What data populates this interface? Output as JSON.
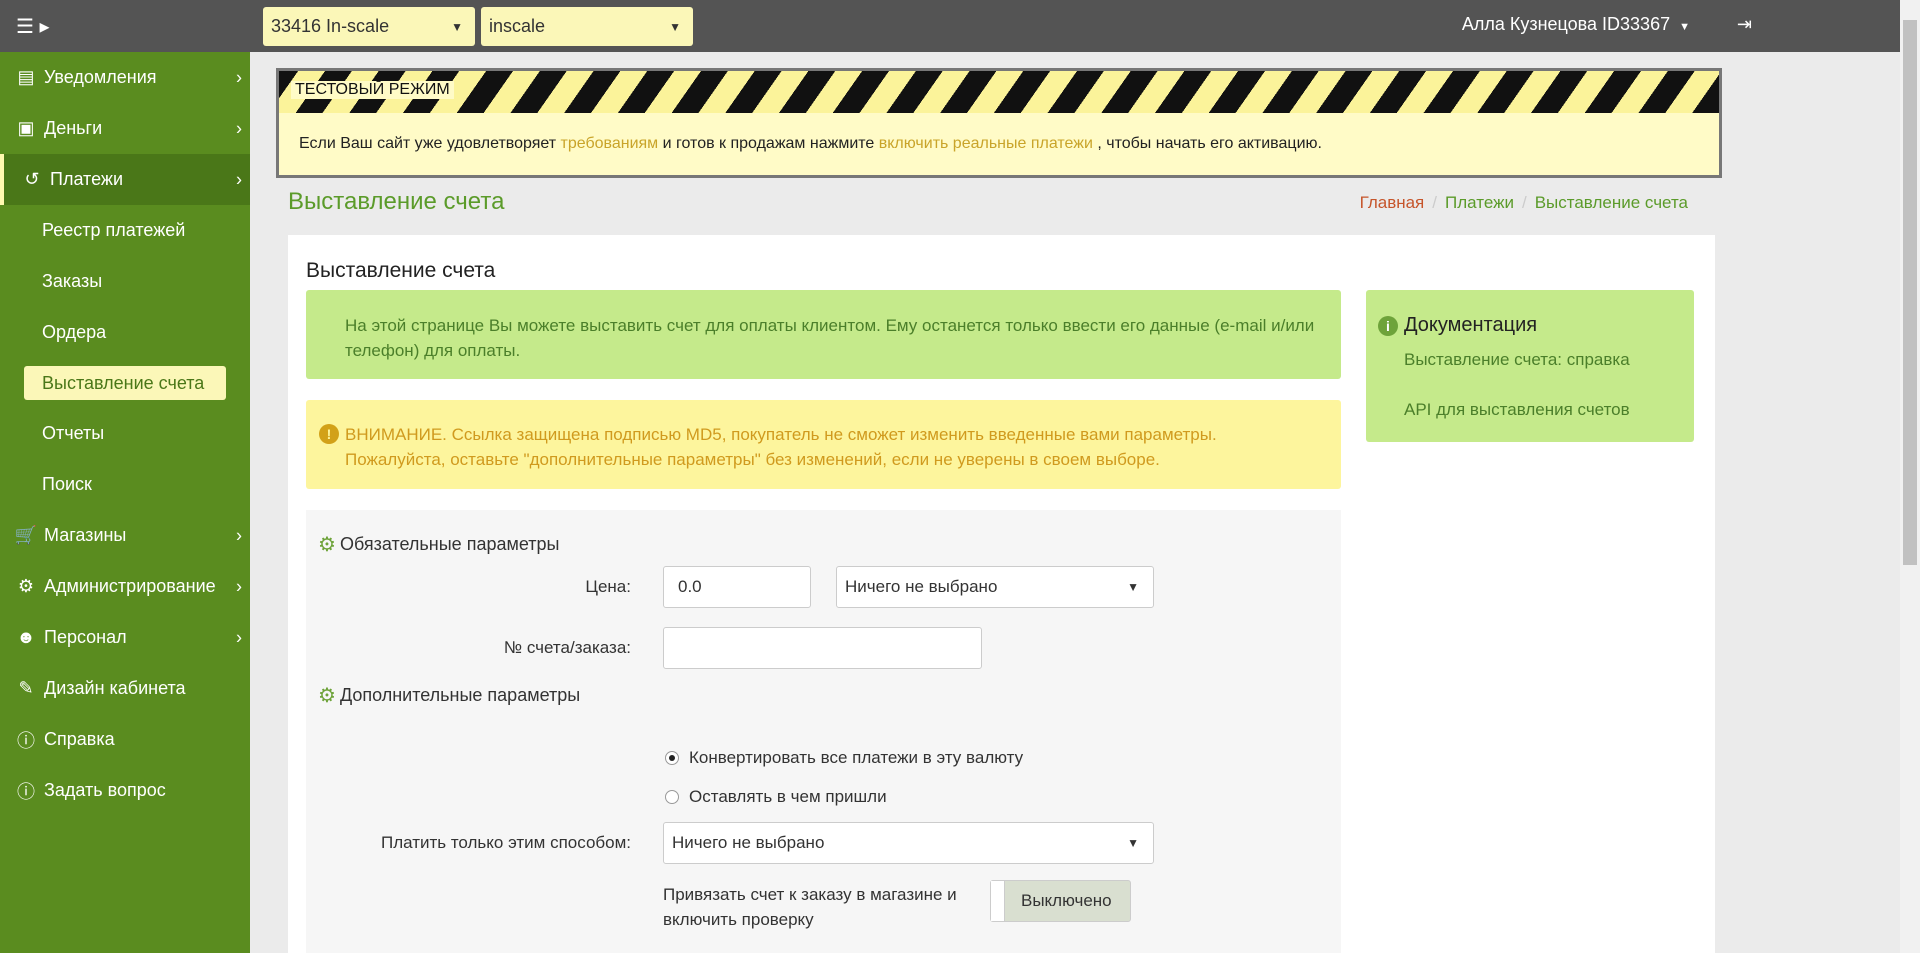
{
  "topbar": {
    "menu_icon": "hamburger-icon",
    "merchant_select": "33416 In-scale",
    "site_select": "inscale",
    "user": "Алла Кузнецова ID33367",
    "logout_icon": "logout-icon"
  },
  "sidebar": {
    "items": [
      {
        "label": "Уведомления",
        "icon": "newspaper-icon"
      },
      {
        "label": "Деньги",
        "icon": "money-icon"
      },
      {
        "label": "Платежи",
        "icon": "history-icon"
      },
      {
        "label": "Магазины",
        "icon": "cart-icon"
      },
      {
        "label": "Администрирование",
        "icon": "gear-icon"
      },
      {
        "label": "Персонал",
        "icon": "users-icon"
      },
      {
        "label": "Дизайн кабинета",
        "icon": "brush-icon"
      },
      {
        "label": "Справка",
        "icon": "info-icon"
      },
      {
        "label": "Задать вопрос",
        "icon": "info-icon"
      }
    ],
    "payments_sub": [
      "Реестр платежей",
      "Заказы",
      "Ордера",
      "Выставление счета",
      "Отчеты",
      "Поиск"
    ]
  },
  "banner": {
    "label": "ТЕСТОВЫЙ РЕЖИМ",
    "text_before": "Если Ваш сайт уже удовлетворяет ",
    "link1": "требованиям",
    "text_mid": " и готов к продажам нажмите ",
    "link2": "включить реальные платежи",
    "text_after": " , чтобы начать его активацию."
  },
  "page": {
    "title": "Выставление счета",
    "breadcrumb": [
      "Главная",
      "Платежи",
      "Выставление счета"
    ]
  },
  "panel": {
    "title": "Выставление счета",
    "info_text": "На этой странице Вы можете выставить счет для оплаты клиентом. Ему останется только ввести его данные (e-mail и/или телефон) для оплаты.",
    "warning_text": "ВНИМАНИЕ. Ссылка защищена подписью MD5, покупатель не сможет изменить введенные вами параметры. Пожалуйста, оставьте \"дополнительные параметры\" без изменений, если не уверены в своем выборе."
  },
  "docs": {
    "title": "Документация",
    "links": [
      "Выставление счета: справка",
      "API для выставления счетов"
    ]
  },
  "form": {
    "required_section": "Обязательные параметры",
    "price_label": "Цена:",
    "price_value": "0.0",
    "currency_select": "Ничего не выбрано",
    "order_label": "№ счета/заказа:",
    "order_value": "",
    "additional_section": "Дополнительные параметры",
    "radio_convert": "Конвертировать все платежи в эту валюту",
    "radio_keep": "Оставлять в чем пришли",
    "method_label": "Платить только этим способом:",
    "method_select": "Ничего не выбрано",
    "bind_label": "Привязать счет к заказу в магазине и включить проверку",
    "bind_toggle": "Выключено"
  }
}
